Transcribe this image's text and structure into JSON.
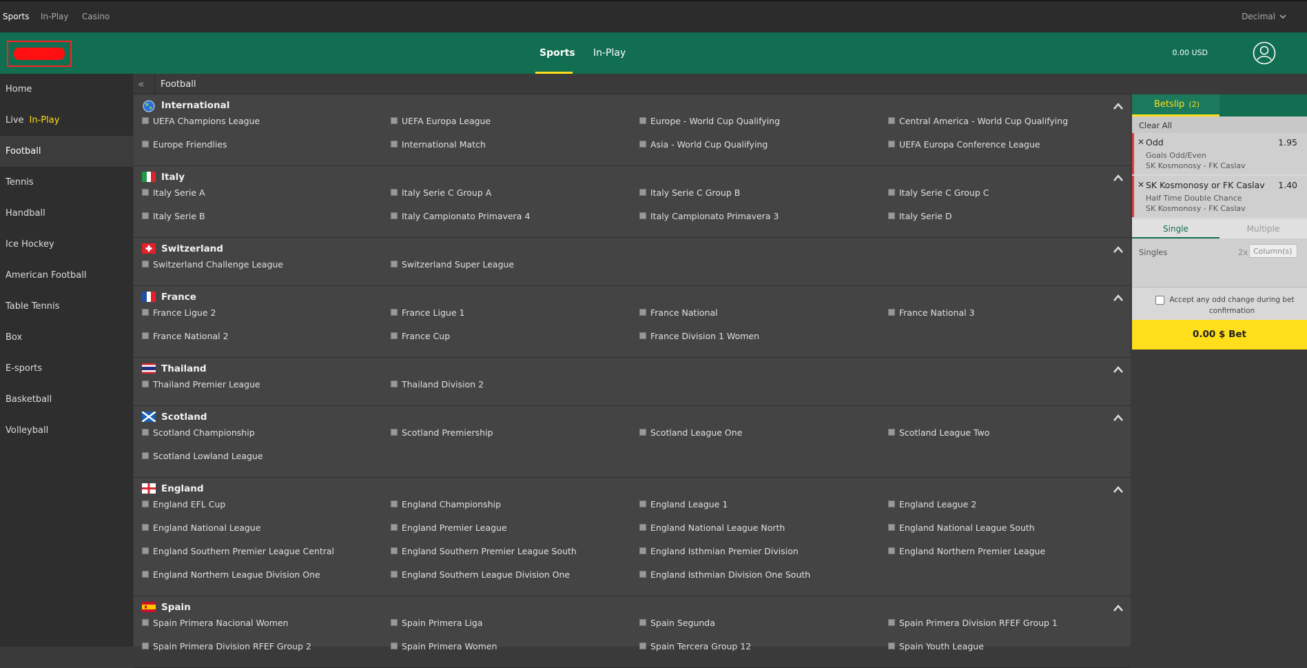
{
  "topbar": {
    "links": [
      "Sports",
      "In-Play",
      "Casino"
    ],
    "odds_format": "Decimal"
  },
  "header": {
    "nav": [
      "Sports",
      "In-Play"
    ],
    "balance": "0.00 USD"
  },
  "sidebar": {
    "items": [
      {
        "label": "Home"
      },
      {
        "label": "Live",
        "tag": "In-Play"
      },
      {
        "label": "Football"
      },
      {
        "label": "Tennis"
      },
      {
        "label": "Handball"
      },
      {
        "label": "Ice Hockey"
      },
      {
        "label": "American Football"
      },
      {
        "label": "Table Tennis"
      },
      {
        "label": "Box"
      },
      {
        "label": "E-sports"
      },
      {
        "label": "Basketball"
      },
      {
        "label": "Volleyball"
      }
    ]
  },
  "breadcrumb": {
    "title": "Football"
  },
  "sections": [
    {
      "name": "International",
      "flag": "globe-icon",
      "leagues": [
        "UEFA Champions League",
        "UEFA Europa League",
        "Europe - World Cup Qualifying",
        "Central America - World Cup Qualifying",
        "Europe Friendlies",
        "International Match",
        "Asia - World Cup Qualifying",
        "UEFA Europa Conference League"
      ]
    },
    {
      "name": "Italy",
      "flag": "italy-flag-icon",
      "leagues": [
        "Italy Serie A",
        "Italy Serie C Group A",
        "Italy Serie C Group B",
        "Italy Serie C Group C",
        "Italy Serie B",
        "Italy Campionato Primavera 4",
        "Italy Campionato Primavera 3",
        "Italy Serie D"
      ]
    },
    {
      "name": "Switzerland",
      "flag": "switzerland-flag-icon",
      "leagues": [
        "Switzerland Challenge League",
        "Switzerland Super League"
      ]
    },
    {
      "name": "France",
      "flag": "france-flag-icon",
      "leagues": [
        "France Ligue 2",
        "France Ligue 1",
        "France National",
        "France National 3",
        "France National 2",
        "France Cup",
        "France Division 1 Women"
      ]
    },
    {
      "name": "Thailand",
      "flag": "thailand-flag-icon",
      "leagues": [
        "Thailand Premier League",
        "Thailand Division 2"
      ]
    },
    {
      "name": "Scotland",
      "flag": "scotland-flag-icon",
      "leagues": [
        "Scotland Championship",
        "Scotland Premiership",
        "Scotland League One",
        "Scotland League Two",
        "Scotland Lowland League"
      ]
    },
    {
      "name": "England",
      "flag": "england-flag-icon",
      "leagues": [
        "England EFL Cup",
        "England Championship",
        "England League 1",
        "England League 2",
        "England National League",
        "England Premier League",
        "England National League North",
        "England National League South",
        "England Southern Premier League Central",
        "England Southern Premier League South",
        "England Isthmian Premier Division",
        "England Northern Premier League",
        "England Northern League Division One",
        "England Southern League Division One",
        "England Isthmian Division One South"
      ]
    },
    {
      "name": "Spain",
      "flag": "spain-flag-icon",
      "leagues": [
        "Spain Primera Nacional Women",
        "Spain Primera Liga",
        "Spain Segunda",
        "Spain Primera Division RFEF Group 1",
        "Spain Primera Division RFEF Group 2",
        "Spain Primera Women",
        "Spain Tercera Group 12",
        "Spain Youth League"
      ]
    }
  ],
  "betslip": {
    "title": "Betslip",
    "count": "(2)",
    "clear_all": "Clear All",
    "selections": [
      {
        "name": "Odd",
        "odds": "1.95",
        "market": "Goals Odd/Even",
        "match": "SK Kosmonosy - FK Caslav"
      },
      {
        "name": "SK Kosmonosy or FK Caslav",
        "odds": "1.40",
        "market": "Half Time Double Chance",
        "match": "SK Kosmonosy - FK Caslav"
      }
    ],
    "mode_single": "Single",
    "mode_multiple": "Multiple",
    "singles_label": "Singles",
    "singles_multiplier": "2x",
    "column_placeholder": "Column(s)",
    "accept_text": "Accept any odd change during bet confirmation",
    "place_bet": "0.00 $ Bet"
  },
  "colors": {
    "brand_green": "#126e51",
    "accent_yellow": "#ffdf1b",
    "page_bg": "#444444",
    "sidebar_bg": "#2e2e2e"
  }
}
